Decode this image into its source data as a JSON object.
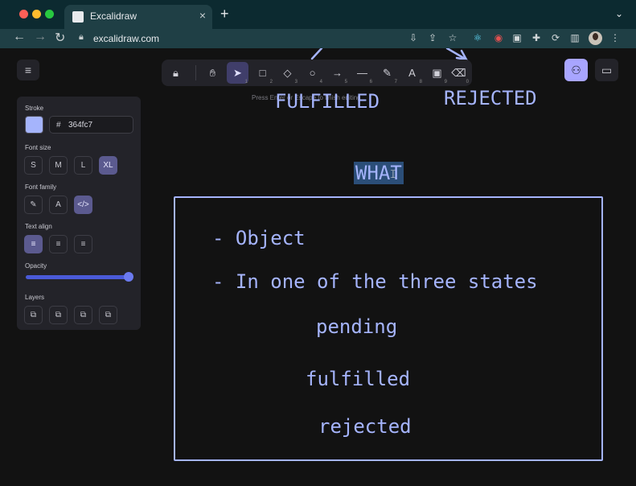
{
  "browser": {
    "tab_title": "Excalidraw",
    "tab_close": "×",
    "new_tab": "+",
    "tab_menu": "⌄",
    "url": "excalidraw.com",
    "nav": {
      "back": "←",
      "forward": "→",
      "reload": "↻"
    },
    "extensions": [
      "install-app-icon",
      "share-icon",
      "bookmark-star-icon",
      "react-devtools-icon",
      "extension-red-icon",
      "extension-box-icon",
      "puzzle-icon",
      "sync-icon",
      "sidebar-icon"
    ],
    "menu": "⋮"
  },
  "app": {
    "menu_icon": "≡",
    "library_icon": "▭",
    "collab_icon": "⚇",
    "tools": [
      {
        "name": "lock",
        "glyph": "🔒︎",
        "key": ""
      },
      {
        "name": "hand",
        "glyph": "✋︎",
        "key": ""
      },
      {
        "name": "selection",
        "glyph": "➤",
        "key": "1"
      },
      {
        "name": "rectangle",
        "glyph": "□",
        "key": "2"
      },
      {
        "name": "diamond",
        "glyph": "◇",
        "key": "3"
      },
      {
        "name": "ellipse",
        "glyph": "○",
        "key": "4"
      },
      {
        "name": "arrow",
        "glyph": "→",
        "key": "5"
      },
      {
        "name": "line",
        "glyph": "—",
        "key": "6"
      },
      {
        "name": "draw",
        "glyph": "✎",
        "key": "7"
      },
      {
        "name": "text",
        "glyph": "A",
        "key": "8"
      },
      {
        "name": "image",
        "glyph": "▣",
        "key": "9"
      },
      {
        "name": "eraser",
        "glyph": "⌫",
        "key": "0"
      }
    ],
    "hint": "Press Enter or Escape to finish editing"
  },
  "properties": {
    "stroke_label": "Stroke",
    "hash": "#",
    "stroke_hex": "364fc7",
    "stroke_color": "#a5b4fc",
    "font_size_label": "Font size",
    "font_sizes": [
      "S",
      "M",
      "L",
      "XL"
    ],
    "font_size_selected": "XL",
    "font_family_label": "Font family",
    "font_families": [
      "✎",
      "A",
      "</>"
    ],
    "text_align_label": "Text align",
    "text_aligns": [
      "≡",
      "≡",
      "≡"
    ],
    "opacity_label": "Opacity",
    "opacity": 1.0,
    "layers_label": "Layers",
    "layers": [
      "⧉",
      "⧉",
      "⧉",
      "⧉"
    ]
  },
  "drawing": {
    "fulfilled_top": "FULFILLED",
    "rejected_top": "REJECTED",
    "what": "WHAT",
    "line1": "- Object",
    "line2": "- In one of the three states",
    "state1": "pending",
    "state2": "fulfilled",
    "state3": "rejected",
    "ink_color": "#a5b4fc"
  }
}
